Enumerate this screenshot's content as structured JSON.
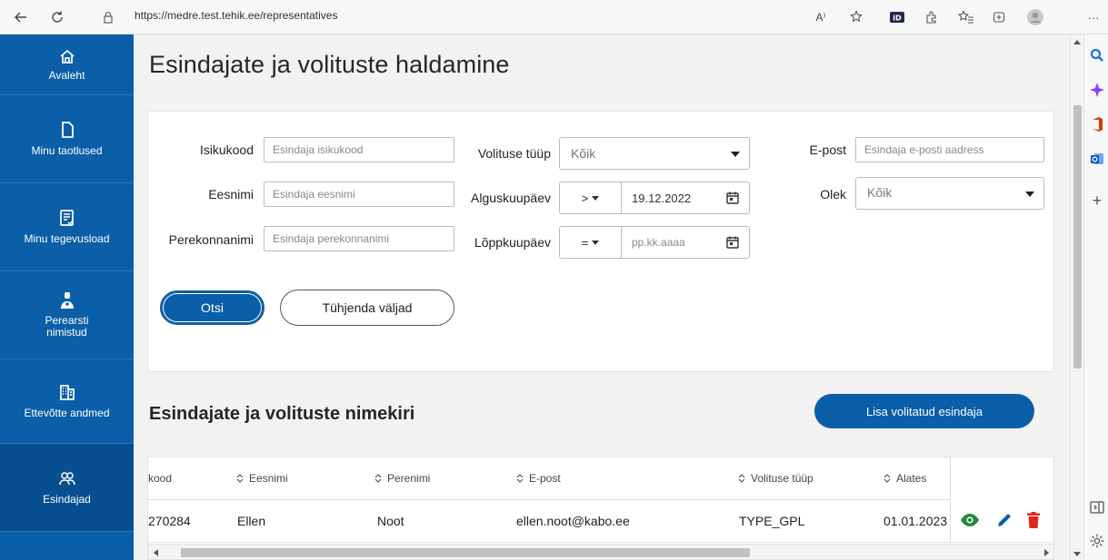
{
  "browser": {
    "url": "https://medre.test.tehik.ee/representatives",
    "more": "···",
    "read_aloud": "A⁾",
    "new_tab": "+"
  },
  "nav": {
    "items": [
      {
        "label": "Avaleht",
        "icon": "home-icon"
      },
      {
        "label": "Minu taotlused",
        "icon": "document-icon"
      },
      {
        "label": "Minu tegevusload",
        "icon": "license-icon"
      },
      {
        "label": "Perearsti nimistud",
        "icon": "doctor-icon"
      },
      {
        "label": "Ettevõtte andmed",
        "icon": "building-icon"
      },
      {
        "label": "Esindajad",
        "icon": "people-icon",
        "active": true
      }
    ]
  },
  "page": {
    "title": "Esindajate ja volituste haldamine",
    "list_title": "Esindajate ja volituste nimekiri",
    "add_button": "Lisa volitatud esindaja"
  },
  "filters": {
    "isikukood": {
      "label": "Isikukood",
      "placeholder": "Esindaja isikukood"
    },
    "eesnimi": {
      "label": "Eesnimi",
      "placeholder": "Esindaja eesnimi"
    },
    "perekonnanimi": {
      "label": "Perekonnanimi",
      "placeholder": "Esindaja perekonnanimi"
    },
    "volituse_tyyp": {
      "label": "Volituse tüüp",
      "value": "Kõik"
    },
    "alguskuupaev": {
      "label": "Alguskuupäev",
      "operator": ">",
      "value": "19.12.2022"
    },
    "loppkuupaev": {
      "label": "Lõppkuupäev",
      "operator": "=",
      "placeholder": "pp.kk.aaaa"
    },
    "epost": {
      "label": "E-post",
      "placeholder": "Esindaja e-posti aadress"
    },
    "olek": {
      "label": "Olek",
      "value": "Kõik"
    },
    "search_button": "Otsi",
    "clear_button": "Tühjenda väljad"
  },
  "table": {
    "columns": [
      "kood",
      "Eesnimi",
      "Perenimi",
      "E-post",
      "Volituse tüüp",
      "Alates"
    ],
    "rows": [
      {
        "kood": "270284",
        "eesnimi": "Ellen",
        "perenimi": "Noot",
        "epost": "ellen.noot@kabo.ee",
        "tyyp": "TYPE_GPL",
        "alates": "01.01.2023"
      }
    ]
  },
  "colors": {
    "primary": "#0b5ea8",
    "view_icon": "#1e8a3c",
    "edit_icon": "#0b5ea8",
    "delete_icon": "#e0261b"
  }
}
